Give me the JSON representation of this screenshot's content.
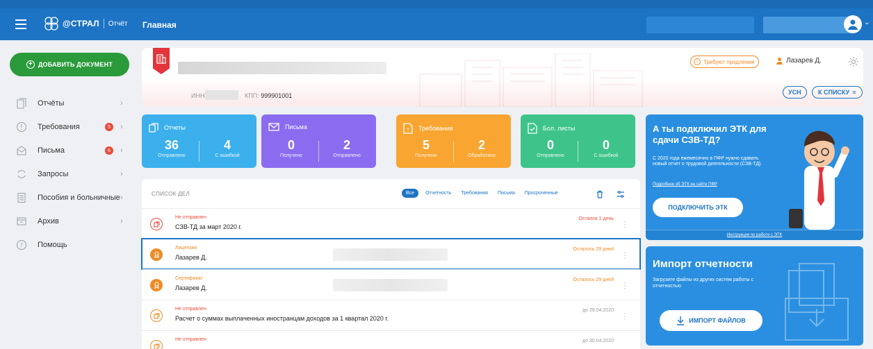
{
  "header": {
    "brand": "@СТРАЛ",
    "product": "Отчёт",
    "title": "Главная"
  },
  "sidebar": {
    "add_document": "ДОБАВИТЬ ДОКУМЕНТ",
    "items": [
      {
        "label": "Отчёты",
        "badge": ""
      },
      {
        "label": "Требования",
        "badge": "5"
      },
      {
        "label": "Письма",
        "badge": "6"
      },
      {
        "label": "Запросы",
        "badge": ""
      },
      {
        "label": "Пособия и больничные",
        "badge": ""
      },
      {
        "label": "Архив",
        "badge": ""
      },
      {
        "label": "Помощь",
        "badge": ""
      }
    ]
  },
  "company": {
    "inn_label": "ИНН",
    "kpp_label": "КПП:",
    "kpp_value": "999901001",
    "renew_label": "Требуют продления",
    "owner": "Лазарев Д.",
    "tax_pill": "УСН",
    "list_pill": "К СПИСКУ"
  },
  "tiles": [
    {
      "title": "Отчеты",
      "color": "#3bb0ec",
      "a_num": "36",
      "a_cap": "Отправлено",
      "b_num": "4",
      "b_cap": "С ошибкой"
    },
    {
      "title": "Письма",
      "color": "#8b6cf0",
      "a_num": "0",
      "a_cap": "Получено",
      "b_num": "2",
      "b_cap": "Отправлено"
    },
    {
      "title": "Требования",
      "color": "#f8a531",
      "a_num": "5",
      "a_cap": "Получено",
      "b_num": "2",
      "b_cap": "Обработано"
    },
    {
      "title": "Бол. листы",
      "color": "#3ec48a",
      "a_num": "0",
      "a_cap": "Отправлено",
      "b_num": "0",
      "b_cap": "С ошибкой"
    }
  ],
  "tasks": {
    "title": "СПИСОК ДЕЛ",
    "filters": [
      "Все",
      "Отчетность",
      "Требования",
      "Письма",
      "Просроченные"
    ],
    "rows": [
      {
        "status": "Не отправлен",
        "status_color": "#e94b3c",
        "title": "СЗВ-ТД за март 2020 г.",
        "due": "Остался 1 день",
        "due_color": "#e94b3c"
      },
      {
        "status": "Лицензия",
        "status_color": "#f08a24",
        "title": "Лазарев Д.",
        "due": "Осталось 29 дней",
        "due_color": "#f08a24"
      },
      {
        "status": "Сертификат",
        "status_color": "#f08a24",
        "title": "Лазарев Д.",
        "due": "Осталось 29 дней",
        "due_color": "#f08a24"
      },
      {
        "status": "Не отправлен",
        "status_color": "#e94b3c",
        "title": "Расчет о суммах выплаченных иностранцам доходов за 1 квартал 2020 г.",
        "due": "до 28.04.2020",
        "due_color": "#999999"
      },
      {
        "status": "Не отправлен",
        "status_color": "#e94b3c",
        "title": "",
        "due": "до 30.04.2020",
        "due_color": "#999999"
      }
    ]
  },
  "promo_etk": {
    "heading": "А ты подключил ЭТК для сдачи СЗВ-ТД?",
    "text": "С 2020 года ежемесячно в ПФР нужно сдавать новый отчет о трудовой деятельности (СЗВ-ТД).",
    "link": "Подробнее об ЭТК на сайте ПФР",
    "button": "ПОДКЛЮЧИТЬ ЭТК",
    "footer": "Инструкция по работе с ЭТК"
  },
  "promo_import": {
    "heading": "Импорт отчетности",
    "text": "Загрузите файлы из других систем работы с отчетностью",
    "button": "ИМПОРТ ФАЙЛОВ"
  }
}
